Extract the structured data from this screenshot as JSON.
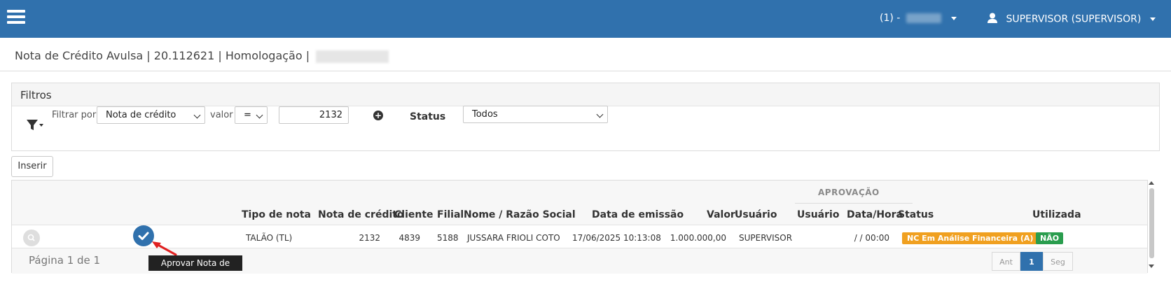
{
  "header": {
    "company_prefix": "(1) -",
    "user": "SUPERVISOR (SUPERVISOR)",
    "menu_icon": "hamburger-menu-icon",
    "user_icon": "user-icon"
  },
  "page": {
    "title": "Nota de Crédito Avulsa | 20.112621 | Homologação |"
  },
  "filters": {
    "title": "Filtros",
    "filter_icon": "funnel-icon",
    "filter_by_label": "Filtrar por",
    "filter_by_value": "Nota de crédito",
    "valor_label": "valor",
    "operator_value": "=",
    "value": "2132",
    "add_icon": "plus-circle-icon",
    "status_label": "Status",
    "status_value": "Todos"
  },
  "actions": {
    "insert_label": "Inserir"
  },
  "grid": {
    "group_label": "APROVAÇÃO",
    "columns": {
      "tipo": "Tipo de nota",
      "nota": "Nota de crédito",
      "cliente": "Cliente",
      "filial": "Filial",
      "nome": "Nome / Razão Social",
      "data": "Data de emissão",
      "valor": "Valor",
      "usuario": "Usuário",
      "aprov_usuario": "Usuário",
      "aprov_data": "Data/Hora",
      "status": "Status",
      "utilizada": "Utilizada"
    },
    "rows": [
      {
        "tipo": "TALÃO (TL)",
        "nota": "2132",
        "cliente": "4839",
        "filial": "5188",
        "nome": "JUSSARA FRIOLI COTO",
        "data": "17/06/2025 10:13:08",
        "valor": "1.000.000,00",
        "usuario": "SUPERVISOR",
        "aprov_usuario": "",
        "aprov_data": "/ / 00:00",
        "status": "NC Em Análise Financeira (A)",
        "utilizada": "NÃO"
      }
    ],
    "page_info": "Página 1 de 1",
    "pager": {
      "prev": "Ant",
      "current": "1",
      "next": "Seg"
    }
  },
  "tooltip": "Aprovar Nota de Crédito",
  "colors": {
    "topbar": "#3071ad",
    "status_orange": "#f0a020",
    "status_green": "#2a9d4e"
  }
}
